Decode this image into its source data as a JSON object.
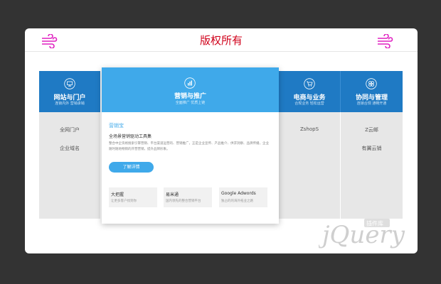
{
  "banner": "版权所有",
  "columns": [
    {
      "title": "网站与门户",
      "subtitle": "连锁内外 营销承销",
      "items": [
        "全网门户",
        "企业域名"
      ]
    },
    {
      "title": "电商与业务",
      "subtitle": "合规业务 轻松运营",
      "items": [
        "ZshopS"
      ]
    },
    {
      "title": "协同与管理",
      "subtitle": "连锁合规 通畅开通",
      "items": [
        "Z云邮",
        "有翼云销"
      ]
    }
  ],
  "featured": {
    "title": "营销与推广",
    "subtitle": "全面推广 优质上链",
    "product_name": "营销宝",
    "tagline": "全场景营销驱动工具集",
    "description": "整合中企资格搜索引擎营销、平台渠道运营的、营销推广，正是企业宣传、产品推介、供求洞察、品牌传播，企业随时随地畅销的开营营销，提升品牌形象。",
    "button": "了解详情",
    "cards": [
      {
        "title": "大把握",
        "desc": "让更多客户找到你"
      },
      {
        "title": "易米通",
        "desc": "国内领先的整合营销平台"
      },
      {
        "title": "Google Adwords",
        "desc": "独占的的海外拓业之路"
      }
    ]
  },
  "watermark": {
    "text": "jQuery",
    "badge": "插件库"
  },
  "colors": {
    "dark_blue": "#1f7ac4",
    "light_blue": "#3fa9ea",
    "banner_red": "#d0021b",
    "wind_icon": "#e020c0"
  }
}
